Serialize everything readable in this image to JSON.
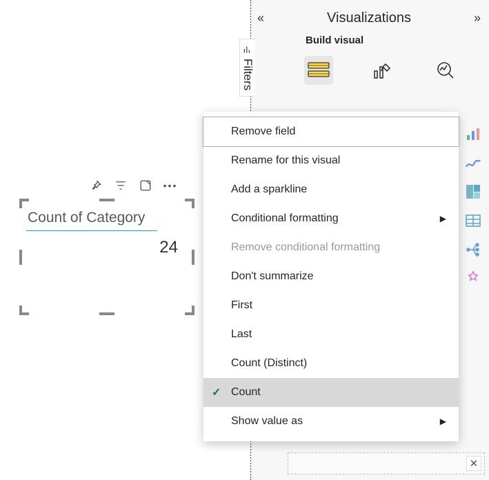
{
  "canvas": {
    "card": {
      "label": "Count of Category",
      "value": "24"
    },
    "toolbar_icons": [
      "pin-icon",
      "filter-icon",
      "focus-icon",
      "more-icon"
    ]
  },
  "filters_tab": "Filters",
  "pane": {
    "title": "Visualizations",
    "subtitle": "Build visual",
    "modes": [
      "build-visual-icon",
      "format-visual-icon",
      "analytics-icon"
    ]
  },
  "viz_strip": [
    "stacked-bar-icon",
    "ribbon-icon",
    "treemap-icon",
    "table-icon",
    "decomposition-icon",
    "key-influencers-icon"
  ],
  "context_menu": {
    "items": [
      {
        "label": "Remove field",
        "state": "hover"
      },
      {
        "label": "Rename for this visual"
      },
      {
        "label": "Add a sparkline"
      },
      {
        "label": "Conditional formatting",
        "submenu": true
      },
      {
        "label": "Remove conditional formatting",
        "state": "disabled"
      },
      {
        "label": "Don't summarize"
      },
      {
        "label": "First"
      },
      {
        "label": "Last"
      },
      {
        "label": "Count (Distinct)"
      },
      {
        "label": "Count",
        "state": "selected",
        "checked": true
      },
      {
        "label": "Show value as",
        "submenu": true
      }
    ]
  },
  "glyphs": {
    "close": "✕"
  }
}
